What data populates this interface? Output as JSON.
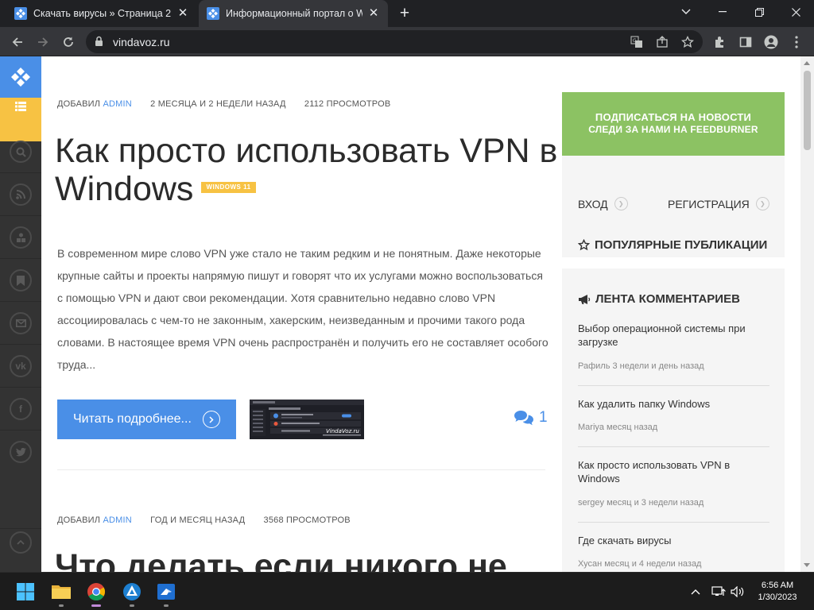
{
  "browser": {
    "tabs": [
      {
        "title": "Скачать вирусы » Страница 2",
        "active": false
      },
      {
        "title": "Информационный портал о Windows",
        "active": true
      }
    ],
    "url": "vindavoz.ru"
  },
  "post1": {
    "meta_prefix": "ДОБАВИЛ",
    "author": "ADMIN",
    "date": "2 МЕСЯЦА И 2 НЕДЕЛИ НАЗАД",
    "views": "2112 ПРОСМОТРОВ",
    "title": "Как просто использовать VPN в Windows",
    "tag": "WINDOWS 11",
    "excerpt": "В современном мире слово VPN уже стало не таким редким и не понятным. Даже некоторые крупные сайты и проекты напрямую пишут и говорят что их услугами можно воспользоваться с помощью VPN и дают свои рекомендации. Хотя сравнительно недавно слово VPN ассоциировалась с чем-то не законным, хакерским, неизведанным и прочими такого рода словами. В настоящее время VPN очень распространён и получить его не составляет особого труда...",
    "read_more": "Читать подробнее...",
    "comment_count": "1",
    "thumb_caption": "VindaVoz.ru"
  },
  "post2": {
    "meta_prefix": "ДОБАВИЛ",
    "author": "ADMIN",
    "date": "ГОД И МЕСЯЦ НАЗАД",
    "views": "3568 ПРОСМОТРОВ",
    "title": "Что делать если никого не"
  },
  "sidebar": {
    "subscribe_line1": "ПОДПИСАТЬСЯ НА НОВОСТИ",
    "subscribe_line2": "СЛЕДИ ЗА НАМИ НА FEEDBURNER",
    "login": "ВХОД",
    "register": "РЕГИСТРАЦИЯ",
    "popular": "ПОПУЛЯРНЫЕ ПУБЛИКАЦИИ",
    "feed_title": "ЛЕНТА КОММЕНТАРИЕВ",
    "feed": [
      {
        "title": "Выбор операционной системы при загрузке",
        "meta": "Рафиль 3 недели и день назад"
      },
      {
        "title": "Как удалить папку Windows",
        "meta": "Mariya месяц назад"
      },
      {
        "title": "Как просто использовать VPN в Windows",
        "meta": "sergey месяц и 3 недели назад"
      },
      {
        "title": "Где скачать вирусы",
        "meta": "Хусан месяц и 4 недели назад"
      }
    ]
  },
  "taskbar": {
    "time": "6:56 AM",
    "date": "1/30/2023"
  },
  "colors": {
    "accent_blue": "#4a8fe7",
    "accent_yellow": "#f7c243",
    "accent_green": "#8cc263",
    "sidebar_dark": "#333333"
  }
}
